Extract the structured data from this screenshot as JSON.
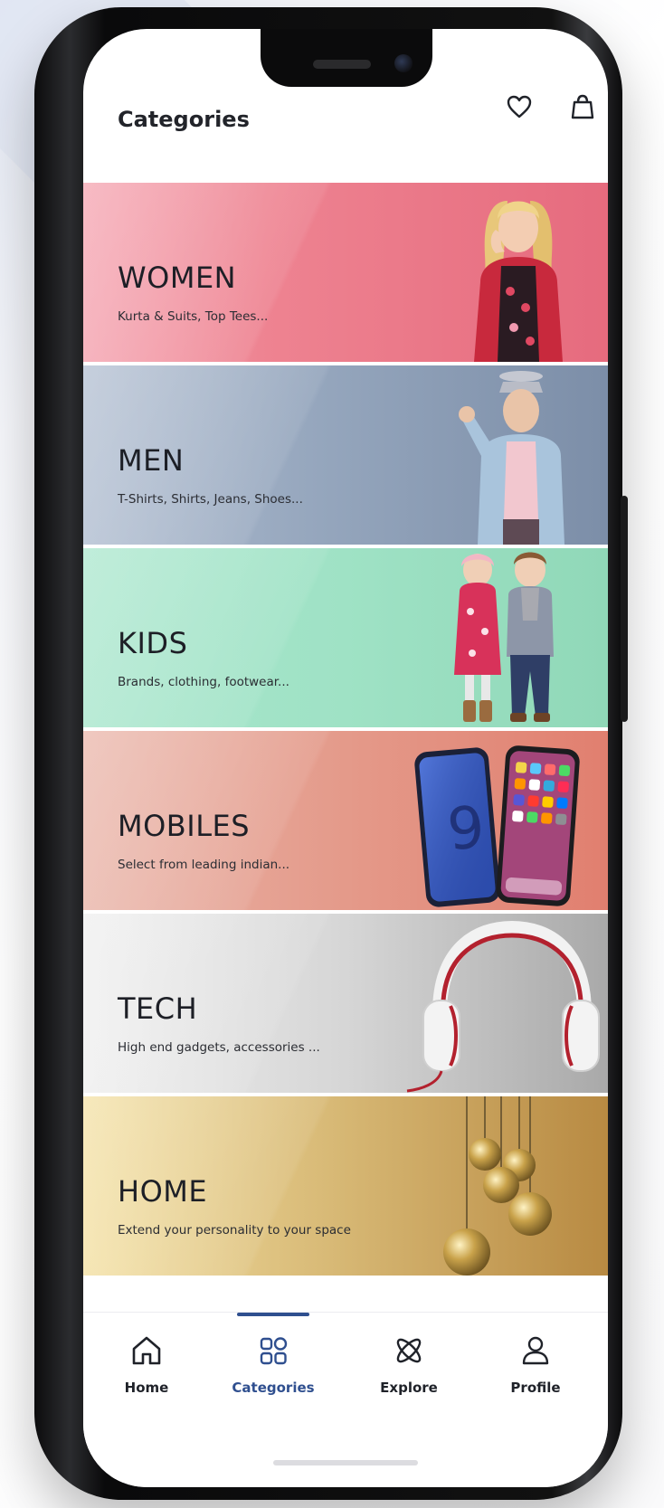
{
  "header": {
    "title": "Categories",
    "icons": [
      "heart-icon",
      "shopping-bag-icon"
    ]
  },
  "categories": [
    {
      "name": "WOMEN",
      "subtitle": "Kurta & Suits, Top Tees...",
      "color": "#ee8391",
      "image": "woman-model-illustration"
    },
    {
      "name": "MEN",
      "subtitle": "T-Shirts, Shirts, Jeans, Shoes...",
      "color": "#95a6bd",
      "image": "man-model-illustration"
    },
    {
      "name": "KIDS",
      "subtitle": "Brands, clothing, footwear...",
      "color": "#9fe2c5",
      "image": "kids-models-illustration"
    },
    {
      "name": "MOBILES",
      "subtitle": "Select from leading indian...",
      "color": "#e49a8a",
      "image": "smartphones-illustration"
    },
    {
      "name": "TECH",
      "subtitle": "High end gadgets, accessories ...",
      "color": "#d6d6d6",
      "image": "headphones-illustration"
    },
    {
      "name": "HOME",
      "subtitle": "Extend your personality to your space",
      "color": "#d9bb78",
      "image": "pendant-lamps-illustration"
    }
  ],
  "nav": [
    {
      "label": "Home",
      "icon": "home-icon",
      "active": false
    },
    {
      "label": "Categories",
      "icon": "categories-icon",
      "active": true
    },
    {
      "label": "Explore",
      "icon": "explore-icon",
      "active": false
    },
    {
      "label": "Profile",
      "icon": "profile-icon",
      "active": false
    }
  ],
  "colors": {
    "accent": "#2f4f8f",
    "text": "#1f2229"
  }
}
